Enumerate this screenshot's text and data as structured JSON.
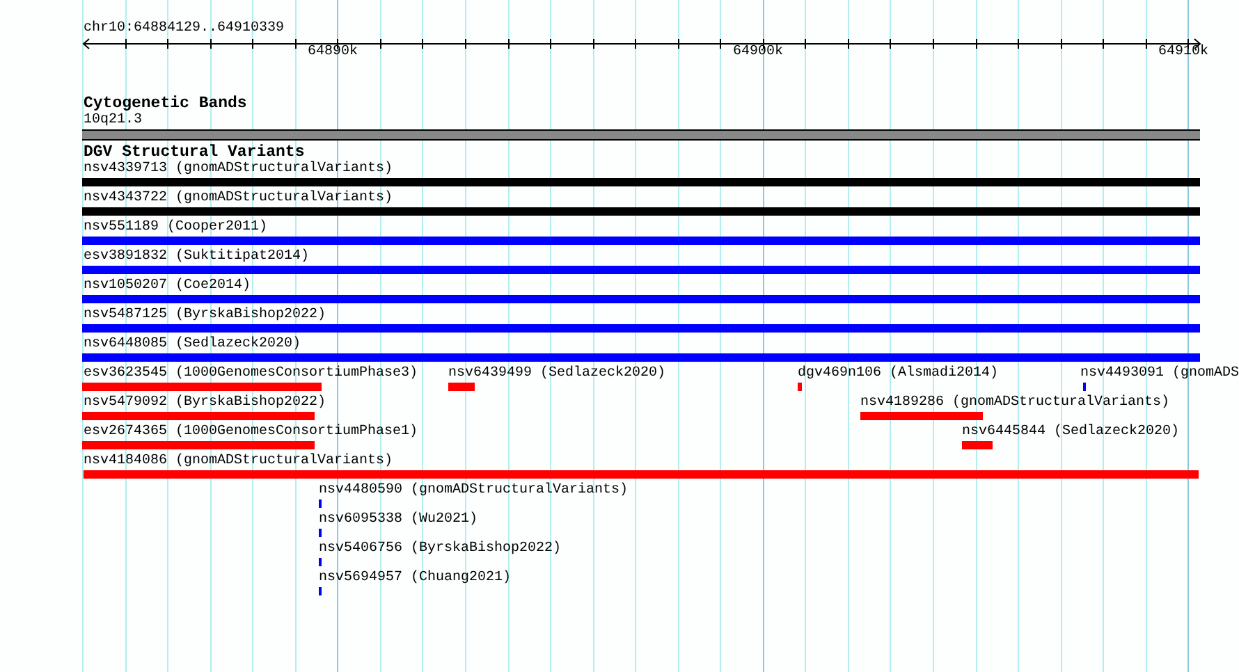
{
  "location": "chr10:64884129..64910339",
  "ruler": {
    "labels": [
      "64890k",
      "64900k",
      "64910k"
    ]
  },
  "tracks": [
    {
      "kind": "bands",
      "title": "Cytogenetic Bands",
      "features": [
        {
          "label": "10q21.3",
          "color": "#888888"
        }
      ]
    },
    {
      "kind": "variants",
      "title": "DGV Structural Variants",
      "features": [
        {
          "label": "nsv4339713 (gnomADStructuralVariants)",
          "color": "#000000"
        },
        {
          "label": "nsv4343722 (gnomADStructuralVariants)",
          "color": "#000000"
        },
        {
          "label": "nsv551189 (Cooper2011)",
          "color": "#0000ff"
        },
        {
          "label": "esv3891832 (Suktitipat2014)",
          "color": "#0000ff"
        },
        {
          "label": "nsv1050207 (Coe2014)",
          "color": "#0000ff"
        },
        {
          "label": "nsv5487125 (ByrskaBishop2022)",
          "color": "#0000ff"
        },
        {
          "label": "nsv6448085 (Sedlazeck2020)",
          "color": "#0000ff"
        },
        {
          "label": "esv3623545 (1000GenomesConsortiumPhase3)",
          "color": "#ff0000"
        },
        {
          "label": "nsv6439499 (Sedlazeck2020)",
          "color": "#ff0000"
        },
        {
          "label": "dgv469n106 (Alsmadi2014)",
          "color": "#ff0000"
        },
        {
          "label": "nsv4493091 (gnomADS",
          "color": "#0000ff"
        },
        {
          "label": "nsv5479092 (ByrskaBishop2022)",
          "color": "#ff0000"
        },
        {
          "label": "nsv4189286 (gnomADStructuralVariants)",
          "color": "#ff0000"
        },
        {
          "label": "esv2674365 (1000GenomesConsortiumPhase1)",
          "color": "#ff0000"
        },
        {
          "label": "nsv6445844 (Sedlazeck2020)",
          "color": "#ff0000"
        },
        {
          "label": "nsv4184086 (gnomADStructuralVariants)",
          "color": "#ff0000"
        },
        {
          "label": "nsv4480590 (gnomADStructuralVariants)",
          "color": "#0000ff"
        },
        {
          "label": "nsv6095338 (Wu2021)",
          "color": "#0000ff"
        },
        {
          "label": "nsv5406756 (ByrskaBishop2022)",
          "color": "#0000ff"
        },
        {
          "label": "nsv5694957 (Chuang2021)",
          "color": "#0000ff"
        }
      ]
    }
  ]
}
